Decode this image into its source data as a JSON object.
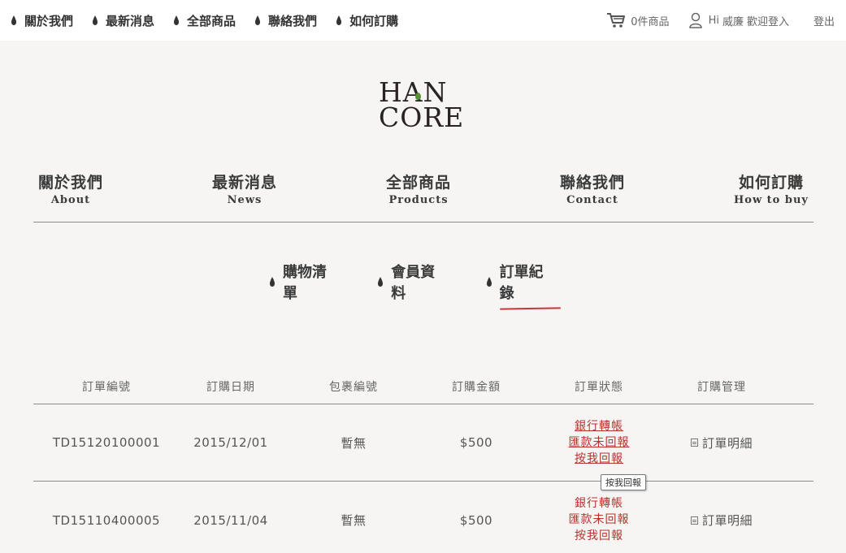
{
  "topbar": {
    "links": [
      "關於我們",
      "最新消息",
      "全部商品",
      "聯絡我們",
      "如何訂購"
    ],
    "cart_label": "0件商品",
    "greeting": "Hi",
    "username": "威廉",
    "welcome": "歡迎登入",
    "logout": "登出"
  },
  "logo": {
    "line1": "HAN",
    "line2": "CORE"
  },
  "mainnav": [
    {
      "zh": "關於我們",
      "en": "About"
    },
    {
      "zh": "最新消息",
      "en": "News"
    },
    {
      "zh": "全部商品",
      "en": "Products"
    },
    {
      "zh": "聯絡我們",
      "en": "Contact"
    },
    {
      "zh": "如何訂購",
      "en": "How to buy"
    }
  ],
  "subnav": {
    "items": [
      "購物清單",
      "會員資料",
      "訂單紀錄"
    ],
    "active_index": 2
  },
  "orders": {
    "headers": [
      "訂單編號",
      "訂購日期",
      "包裹編號",
      "訂購金額",
      "訂單狀態",
      "訂購管理"
    ],
    "rows": [
      {
        "id": "TD15120100001",
        "date": "2015/12/01",
        "package": "暫無",
        "amount": "$500",
        "status": [
          "銀行轉帳",
          "匯款未回報",
          "按我回報"
        ],
        "manage": "訂單明細"
      },
      {
        "id": "TD15110400005",
        "date": "2015/11/04",
        "package": "暫無",
        "amount": "$500",
        "status": [
          "銀行轉帳",
          "匯款未回報",
          "按我回報"
        ],
        "manage": "訂單明細"
      }
    ]
  },
  "tooltip": "按我回報",
  "colors": {
    "accent_red": "#b8322e",
    "underline_red": "#c9363c",
    "logo_green": "#5a8f3a"
  }
}
